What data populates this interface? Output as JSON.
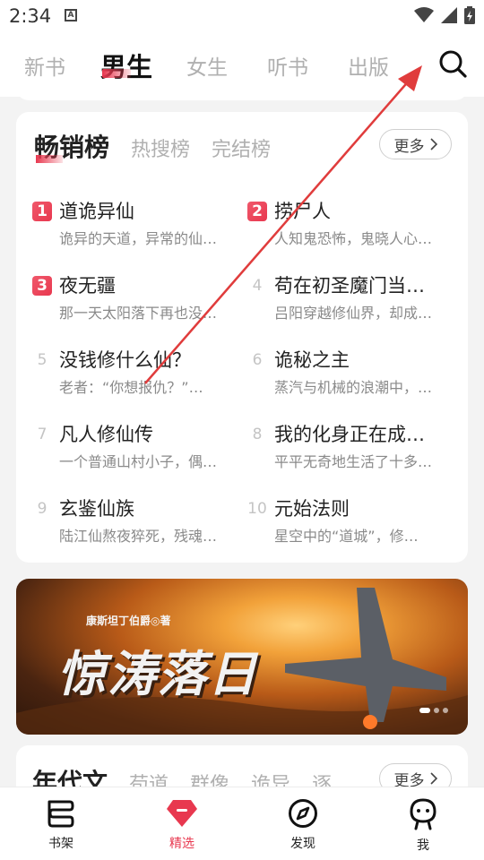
{
  "status_bar": {
    "time": "2:34",
    "notification_icon": "A"
  },
  "top_tabs": [
    {
      "label": "新书",
      "active": false
    },
    {
      "label": "男生",
      "active": true
    },
    {
      "label": "女生",
      "active": false
    },
    {
      "label": "听书",
      "active": false
    },
    {
      "label": "出版",
      "active": false
    }
  ],
  "search": {
    "icon": "search-icon"
  },
  "ranking": {
    "tabs": [
      "畅销榜",
      "热搜榜",
      "完结榜"
    ],
    "more_label": "更多",
    "books": [
      {
        "rank": "1",
        "title": "道诡异仙",
        "desc": "诡异的天道，异常的仙…"
      },
      {
        "rank": "2",
        "title": "捞尸人",
        "desc": "人知鬼恐怖，鬼晓人心…"
      },
      {
        "rank": "3",
        "title": "夜无疆",
        "desc": "那一天太阳落下再也没…"
      },
      {
        "rank": "4",
        "title": "苟在初圣魔门当…",
        "desc": "吕阳穿越修仙界，却成…"
      },
      {
        "rank": "5",
        "title": "没钱修什么仙？",
        "desc": "老者：“你想报仇？”…"
      },
      {
        "rank": "6",
        "title": "诡秘之主",
        "desc": "蒸汽与机械的浪潮中，…"
      },
      {
        "rank": "7",
        "title": "凡人修仙传",
        "desc": "一个普通山村小子，偶…"
      },
      {
        "rank": "8",
        "title": "我的化身正在成…",
        "desc": "平平无奇地生活了十多…"
      },
      {
        "rank": "9",
        "title": "玄鉴仙族",
        "desc": "陆江仙熬夜猝死，残魂…"
      },
      {
        "rank": "10",
        "title": "元始法则",
        "desc": "星空中的“道城”，修…"
      }
    ]
  },
  "banner": {
    "author": "康斯坦丁伯爵◎著",
    "title": "惊涛落日"
  },
  "era_section": {
    "tabs": [
      "年代文",
      "苟道",
      "群像",
      "诡异",
      "逐"
    ],
    "more_label": "更多"
  },
  "bottom_nav": [
    {
      "label": "书架",
      "icon": "bookshelf-icon",
      "active": false
    },
    {
      "label": "精选",
      "icon": "featured-diamond-icon",
      "active": true
    },
    {
      "label": "发现",
      "icon": "compass-icon",
      "active": false
    },
    {
      "label": "我",
      "icon": "profile-icon",
      "active": false
    }
  ],
  "colors": {
    "accent": "#e8384f",
    "annotation": "#e03c3c"
  }
}
